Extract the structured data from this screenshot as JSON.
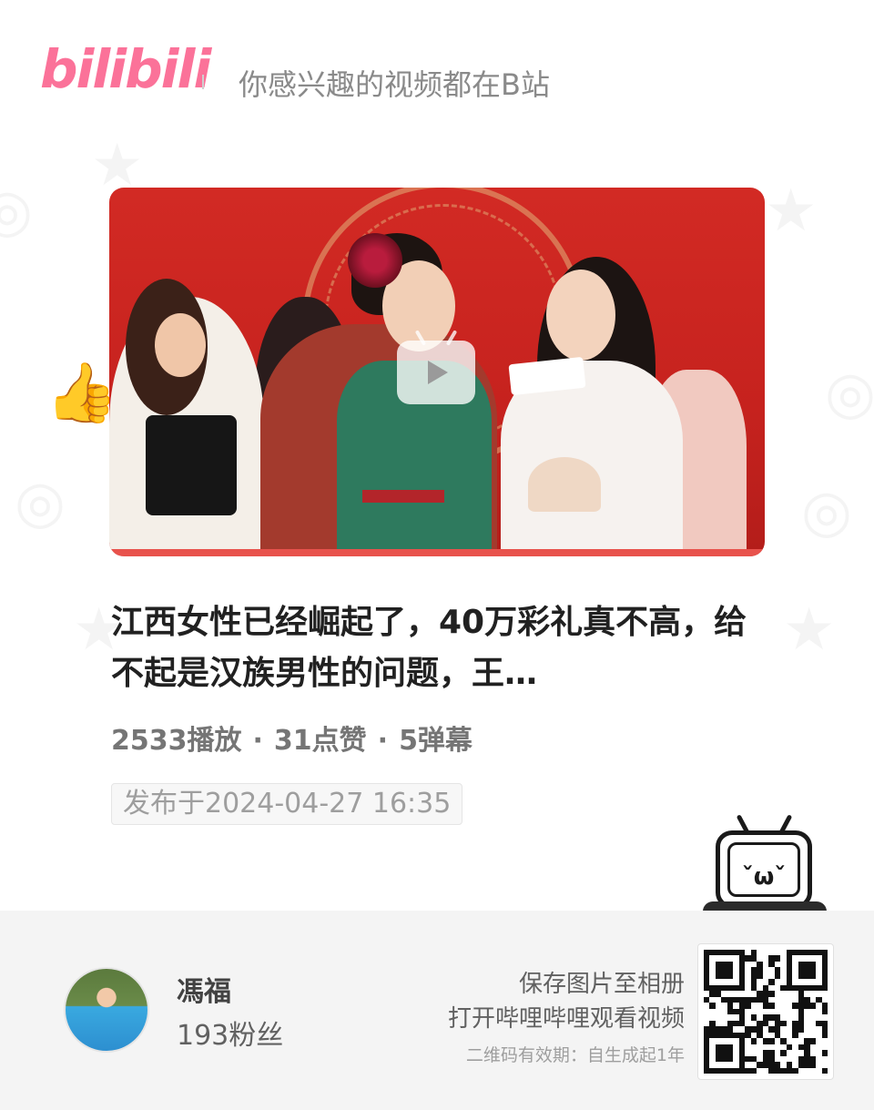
{
  "header": {
    "logo_text": "bilibili",
    "slogan": "你感兴趣的视频都在B站"
  },
  "video": {
    "thumbnail_label": "",
    "play_icon": "tv-play-icon",
    "title": "江西女性已经崛起了，40万彩礼真不高，给不起是汉族男性的问题，王…",
    "stats": {
      "plays": "2533播放",
      "likes": "31点赞",
      "danmaku": "5弹幕",
      "separator": "·"
    },
    "publish_date": "发布于2024-04-27 16:35"
  },
  "uploader": {
    "name": "馮福",
    "fans": "193粉丝"
  },
  "qr_panel": {
    "line1": "保存图片至相册",
    "line2": "打开哔哩哔哩观看视频",
    "line3": "二维码有效期：自生成起1年"
  },
  "colors": {
    "brand_pink": "#fb7299",
    "footer_bg": "#f4f4f4"
  }
}
